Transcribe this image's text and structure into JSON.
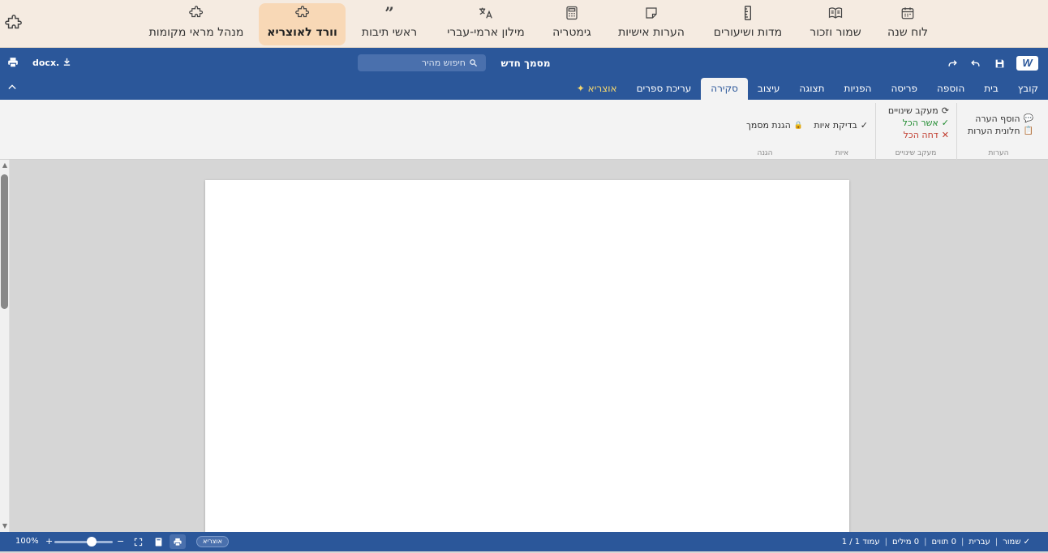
{
  "topnav": {
    "items": [
      {
        "label": "לוח שנה",
        "icon": "calendar-icon"
      },
      {
        "label": "שמור וזכור",
        "icon": "book-icon"
      },
      {
        "label": "מדות ושיעורים",
        "icon": "ruler-icon"
      },
      {
        "label": "הערות אישיות",
        "icon": "note-icon"
      },
      {
        "label": "גימטריה",
        "icon": "calculator-icon"
      },
      {
        "label": "מילון ארמי-עברי",
        "icon": "translate-icon"
      },
      {
        "label": "ראשי תיבות",
        "icon": "quote-icon"
      },
      {
        "label": "וורד לאוצריא",
        "icon": "puzzle-icon",
        "active": true
      },
      {
        "label": "מנהל מראי מקומות",
        "icon": "puzzle-icon"
      }
    ]
  },
  "header": {
    "logo": "W",
    "title": "מסמך חדש",
    "search_placeholder": "חיפוש מהיר",
    "docx_label": "docx."
  },
  "tabs": [
    {
      "label": "קובץ"
    },
    {
      "label": "בית"
    },
    {
      "label": "הוספה"
    },
    {
      "label": "פריסה"
    },
    {
      "label": "הפניות"
    },
    {
      "label": "תצוגה"
    },
    {
      "label": "עיצוב"
    },
    {
      "label": "סקירה",
      "active": true
    },
    {
      "label": "עריכת ספרים"
    },
    {
      "label": "✦ אוצריא",
      "star": true
    }
  ],
  "ribbon": {
    "comments": {
      "label": "הערות",
      "add": "הוסף הערה",
      "pane": "חלונית הערות"
    },
    "tracking": {
      "label": "מעקב שינויים",
      "track": "מעקב שינויים",
      "accept": "אשר הכל",
      "reject": "דחה הכל"
    },
    "spelling": {
      "label": "איות",
      "check": "בדיקת איות"
    },
    "protect": {
      "label": "הגנה",
      "protect_doc": "הגנת מסמך"
    }
  },
  "status": {
    "page": "עמוד 1 / 1",
    "words": "0 מילים",
    "chars": "0 תווים",
    "language": "עברית",
    "saved": "✓ שמור",
    "badge": "אוצריא",
    "zoom": "100%"
  },
  "colors": {
    "brand": "#2b579a",
    "nav_bg": "#f5ebe1",
    "active_nav": "#f8d8b6",
    "accept": "#1e8a2e",
    "reject": "#c0392b"
  }
}
